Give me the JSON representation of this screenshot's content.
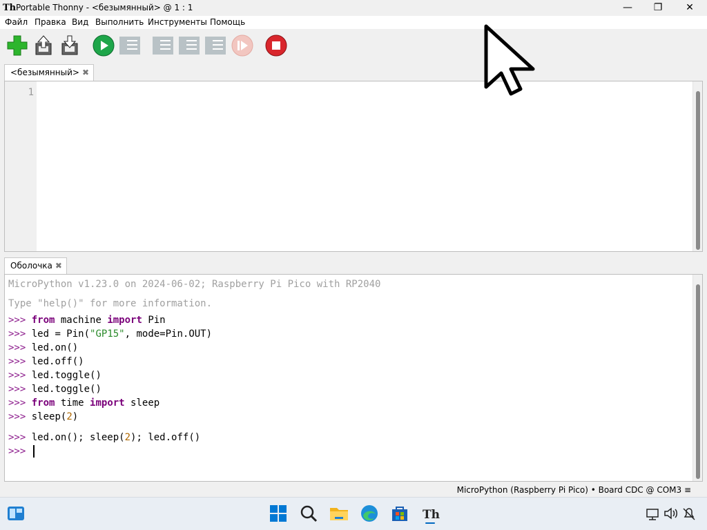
{
  "titlebar": {
    "title": "Portable Thonny  -  <безымянный>  @  1 : 1",
    "icon": "thonny-icon",
    "minimize": "—",
    "maximize": "❐",
    "close": "✕"
  },
  "menu": [
    "Файл",
    "Правка",
    "Вид",
    "Выполнить",
    "Инструменты",
    "Помощь"
  ],
  "toolbar": {
    "buttons": [
      "new-file",
      "open-file",
      "save-file",
      "run",
      "debug",
      "step-over",
      "step-into",
      "step-out",
      "resume",
      "stop"
    ],
    "colors": {
      "new": "#2db52d",
      "run": "#1ea64a",
      "stop": "#d9262c",
      "disabled": "#b9c2c6"
    }
  },
  "editor": {
    "tab_label": "<безымянный>",
    "line_numbers": [
      "1"
    ]
  },
  "shell": {
    "tab_label": "Оболочка",
    "banner1": "MicroPython v1.23.0 on 2024-06-02; Raspberry Pi Pico with RP2040",
    "banner2": "Type \"help()\" for more information.",
    "prompt": ">>>",
    "lines": [
      {
        "prefix": "",
        "kw1": "from",
        "mid1": " machine ",
        "kw2": "import",
        "mid2": " Pin"
      },
      {
        "plain": "led = Pin(",
        "str": "\"GP15\"",
        "tail": ", mode=Pin.OUT)"
      },
      {
        "plain": "led.on()"
      },
      {
        "plain": "led.off()"
      },
      {
        "plain": "led.toggle()"
      },
      {
        "plain": "led.toggle()"
      },
      {
        "prefix": "",
        "kw1": "from",
        "mid1": " time ",
        "kw2": "import",
        "mid2": " sleep"
      },
      {
        "plain": "sleep(",
        "num": "2",
        "tail": ")"
      },
      {
        "plain": "led.on(); sleep(",
        "num": "2",
        "tail": "); led.off()"
      },
      {
        "plain": ""
      }
    ]
  },
  "statusbar": {
    "text": "MicroPython (Raspberry Pi Pico)  •  Board CDC @ COM3  ≡"
  },
  "taskbar": {
    "icons": [
      "widgets-icon",
      "start-icon",
      "search-icon",
      "file-explorer-icon",
      "edge-icon",
      "store-icon",
      "thonny-taskbar-icon"
    ],
    "tray": [
      "network-icon",
      "volume-icon",
      "notification-icon"
    ]
  }
}
